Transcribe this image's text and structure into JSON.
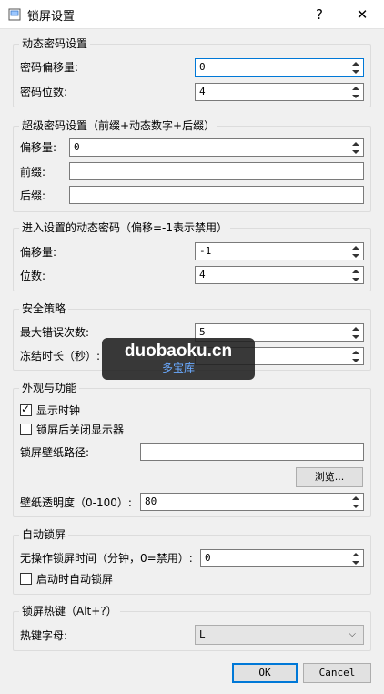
{
  "window": {
    "title": "锁屏设置",
    "help": "?",
    "close": "✕"
  },
  "dynamic": {
    "title": "动态密码设置",
    "offset_label": "密码偏移量:",
    "offset_value": "0",
    "digits_label": "密码位数:",
    "digits_value": "4"
  },
  "super": {
    "title": "超级密码设置（前缀+动态数字+后缀）",
    "offset_label": "偏移量:",
    "offset_value": "0",
    "prefix_label": "前缀:",
    "prefix_value": "",
    "suffix_label": "后缀:",
    "suffix_value": ""
  },
  "enter": {
    "title": "进入设置的动态密码（偏移=-1表示禁用）",
    "offset_label": "偏移量:",
    "offset_value": "-1",
    "digits_label": "位数:",
    "digits_value": "4"
  },
  "security": {
    "title": "安全策略",
    "max_errors_label": "最大错误次数:",
    "max_errors_value": "5",
    "freeze_label": "冻结时长（秒）:"
  },
  "appearance": {
    "title": "外观与功能",
    "show_clock_label": "显示时钟",
    "show_clock_checked": true,
    "close_display_label": "锁屏后关闭显示器",
    "close_display_checked": false,
    "wallpaper_label": "锁屏壁纸路径:",
    "wallpaper_value": "",
    "browse_label": "浏览...",
    "opacity_label": "壁纸透明度（0-100）:",
    "opacity_value": "80"
  },
  "autolock": {
    "title": "自动锁屏",
    "idle_label": "无操作锁屏时间（分钟，0=禁用）:",
    "idle_value": "0",
    "on_start_label": "启动时自动锁屏",
    "on_start_checked": false
  },
  "hotkey": {
    "title": "锁屏热键（Alt+?）",
    "letter_label": "热键字母:",
    "letter_value": "L"
  },
  "buttons": {
    "ok": "OK",
    "cancel": "Cancel"
  },
  "watermark": {
    "line1": "duobaoku.cn",
    "line2": "多宝库"
  }
}
